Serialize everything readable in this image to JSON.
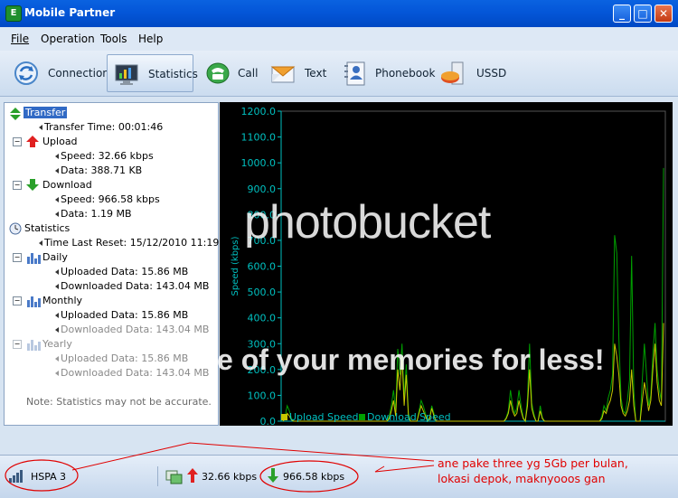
{
  "window": {
    "title": "Mobile Partner"
  },
  "menu": [
    "File",
    "Operation",
    "Tools",
    "Help"
  ],
  "toolbar": {
    "items": [
      {
        "label": "Connection",
        "icon": "connection-icon"
      },
      {
        "label": "Statistics",
        "icon": "statistics-icon"
      },
      {
        "label": "Call",
        "icon": "phone-icon"
      },
      {
        "label": "Text",
        "icon": "envelope-icon"
      },
      {
        "label": "Phonebook",
        "icon": "phonebook-icon"
      },
      {
        "label": "USSD",
        "icon": "ussd-icon"
      }
    ],
    "active": "Statistics"
  },
  "tree": {
    "transfer": "Transfer",
    "transfer_time": "Transfer Time: 00:01:46",
    "upload": "Upload",
    "upload_speed": "Speed: 32.66 kbps",
    "upload_data": "Data: 388.71 KB",
    "download": "Download",
    "download_speed": "Speed: 966.58 kbps",
    "download_data": "Data: 1.19 MB",
    "statistics": "Statistics",
    "last_reset": "Time Last Reset: 15/12/2010 11:19:58",
    "daily": "Daily",
    "daily_up": "Uploaded Data: 15.86 MB",
    "daily_down": "Downloaded Data: 143.04 MB",
    "monthly": "Monthly",
    "monthly_up": "Uploaded Data: 15.86 MB",
    "monthly_down": "Downloaded Data: 143.04 MB",
    "yearly": "Yearly",
    "yearly_up": "Uploaded Data: 15.86 MB",
    "yearly_down": "Downloaded Data: 143.04 MB",
    "note": "Note: Statistics may not be accurate."
  },
  "chart_data": {
    "type": "line",
    "ylabel": "Speed (kbps)",
    "ylim": [
      0,
      1200
    ],
    "yticks": [
      "0.0",
      "100.0",
      "200.0",
      "300.0",
      "400.0",
      "500.0",
      "600.0",
      "700.0",
      "800.0",
      "900.0",
      "1000.0",
      "1100.0",
      "1200.0"
    ],
    "grid": false,
    "legend_position": "bottom",
    "colors": {
      "upload": "#c8c800",
      "download": "#00a000",
      "axis": "#00c0c0",
      "background": "#000000"
    },
    "series": [
      {
        "name": "Upload Speed",
        "values": [
          0,
          10,
          30,
          20,
          5,
          0,
          0,
          0,
          0,
          0,
          0,
          0,
          0,
          0,
          0,
          0,
          0,
          0,
          0,
          0,
          0,
          0,
          0,
          0,
          0,
          0,
          0,
          0,
          0,
          0,
          0,
          0,
          0,
          0,
          0,
          0,
          0,
          0,
          0,
          0,
          0,
          0,
          0,
          0,
          0,
          0,
          0,
          0,
          0,
          0,
          10,
          40,
          80,
          20,
          200,
          120,
          250,
          60,
          180,
          20,
          0,
          0,
          0,
          0,
          30,
          60,
          40,
          20,
          0,
          10,
          50,
          20,
          0,
          0,
          0,
          0,
          0,
          0,
          0,
          0,
          0,
          0,
          0,
          0,
          0,
          0,
          0,
          0,
          0,
          0,
          0,
          0,
          0,
          0,
          0,
          0,
          0,
          0,
          0,
          0,
          0,
          0,
          0,
          0,
          0,
          10,
          30,
          80,
          40,
          20,
          30,
          80,
          40,
          10,
          0,
          60,
          200,
          50,
          20,
          0,
          0,
          40,
          10,
          0,
          0,
          0,
          0,
          0,
          0,
          0,
          0,
          0,
          0,
          0,
          0,
          0,
          0,
          0,
          0,
          0,
          0,
          0,
          0,
          0,
          0,
          0,
          0,
          0,
          0,
          0,
          10,
          40,
          30,
          60,
          80,
          120,
          300,
          250,
          180,
          60,
          30,
          20,
          40,
          80,
          200,
          60,
          0,
          0,
          0,
          80,
          150,
          100,
          40,
          80,
          200,
          300,
          150,
          80,
          60,
          380
        ]
      },
      {
        "name": "Download Speed",
        "values": [
          0,
          20,
          60,
          40,
          10,
          0,
          0,
          0,
          0,
          0,
          0,
          0,
          0,
          0,
          0,
          0,
          0,
          0,
          0,
          0,
          0,
          0,
          0,
          0,
          0,
          0,
          0,
          0,
          0,
          0,
          0,
          0,
          0,
          0,
          0,
          0,
          0,
          0,
          0,
          0,
          0,
          0,
          0,
          0,
          0,
          0,
          0,
          0,
          0,
          0,
          20,
          60,
          120,
          40,
          280,
          180,
          300,
          90,
          220,
          30,
          0,
          0,
          0,
          0,
          40,
          80,
          60,
          30,
          0,
          15,
          60,
          30,
          0,
          0,
          0,
          0,
          0,
          0,
          0,
          0,
          0,
          0,
          0,
          0,
          0,
          0,
          0,
          0,
          0,
          0,
          0,
          0,
          0,
          0,
          0,
          0,
          0,
          0,
          0,
          0,
          0,
          0,
          0,
          0,
          0,
          15,
          40,
          120,
          60,
          30,
          50,
          120,
          60,
          15,
          0,
          90,
          300,
          70,
          30,
          0,
          0,
          60,
          15,
          0,
          0,
          0,
          0,
          0,
          0,
          0,
          0,
          0,
          0,
          0,
          0,
          0,
          0,
          0,
          0,
          0,
          0,
          0,
          0,
          0,
          0,
          0,
          0,
          0,
          0,
          0,
          20,
          60,
          40,
          90,
          120,
          180,
          720,
          650,
          320,
          90,
          40,
          30,
          80,
          160,
          640,
          120,
          0,
          0,
          0,
          160,
          300,
          180,
          60,
          100,
          260,
          380,
          200,
          120,
          80,
          980
        ]
      }
    ]
  },
  "status": {
    "network": "HSPA",
    "signal": "3",
    "upload_speed": "32.66 kbps",
    "download_speed": "966.58 kbps"
  },
  "annotation": [
    "ane pake three yg 5Gb per bulan,",
    "lokasi depok, maknyooos gan"
  ],
  "watermark": [
    "photobucket",
    "e of your memories for less!"
  ]
}
